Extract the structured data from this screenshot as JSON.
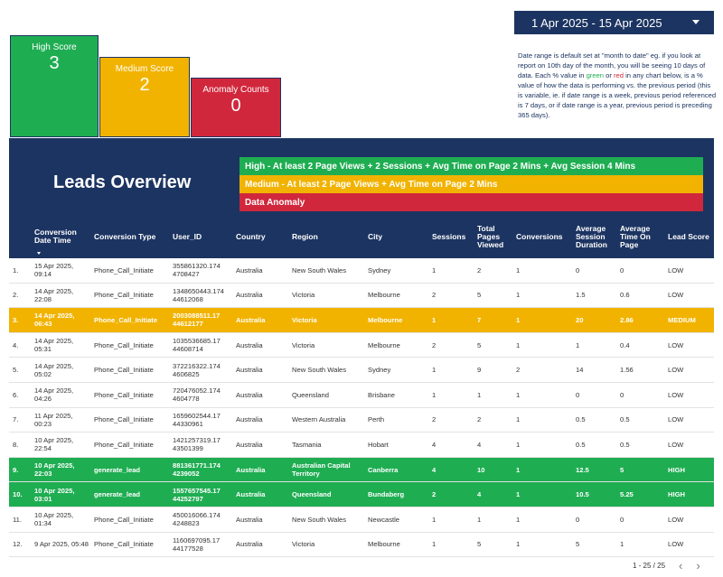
{
  "scorecards": {
    "high": {
      "label": "High Score",
      "value": "3"
    },
    "medium": {
      "label": "Medium Score",
      "value": "2"
    },
    "anomaly": {
      "label": "Anomaly Counts",
      "value": "0"
    }
  },
  "date_range": {
    "label": "1 Apr 2025 - 15 Apr 2025"
  },
  "note": {
    "part1": "Date range is default set at \"month to date\" eg. if you look at report on 10th day of the month, you will be seeing 10 days of data. Each % value in ",
    "green": "green",
    "mid": " or ",
    "red": "red",
    "part2": " in any chart below, is a % value of how the data is performing vs. the previous period (this is variable, ie. if date range is a week, previous period referenced is 7 days, or if date range is a year, previous period is preceding 365 days)."
  },
  "banner": {
    "title": "Leads Overview",
    "legend_high": "High -  At least 2 Page Views + 2 Sessions + Avg Time on Page 2 Mins + Avg Session 4 Mins",
    "legend_medium": "Medium -  At least 2 Page Views + Avg Time on Page 2 Mins",
    "legend_anomaly": "Data Anomaly"
  },
  "colors": {
    "navy": "#1c3461",
    "high": "#1fad52",
    "medium": "#f1b300",
    "anomaly": "#d1273c"
  },
  "table": {
    "columns": [
      "",
      "Conversion Date Time",
      "Conversion Type",
      "User_ID",
      "Country",
      "Region",
      "City",
      "Sessions",
      "Total Pages Viewed",
      "Conversions",
      "Average Session Duration",
      "Average Time On Page",
      "Lead Score"
    ],
    "rows": [
      [
        "1.",
        "15 Apr 2025, 09:14",
        "Phone_Call_Initiate",
        "355861320.174 4708427",
        "Australia",
        "New South Wales",
        "Sydney",
        "1",
        "2",
        "1",
        "0",
        "0",
        "LOW"
      ],
      [
        "2.",
        "14 Apr 2025, 22:08",
        "Phone_Call_Initiate",
        "1348650443.174 44612068",
        "Australia",
        "Victoria",
        "Melbourne",
        "2",
        "5",
        "1",
        "1.5",
        "0.6",
        "LOW"
      ],
      [
        "3.",
        "14 Apr 2025, 06:43",
        "Phone_Call_Initiate",
        "2003088511.17 44612177",
        "Australia",
        "Victoria",
        "Melbourne",
        "1",
        "7",
        "1",
        "20",
        "2.86",
        "MEDIUM"
      ],
      [
        "4.",
        "14 Apr 2025, 05:31",
        "Phone_Call_Initiate",
        "1035536685.17 44608714",
        "Australia",
        "Victoria",
        "Melbourne",
        "2",
        "5",
        "1",
        "1",
        "0.4",
        "LOW"
      ],
      [
        "5.",
        "14 Apr 2025, 05:02",
        "Phone_Call_Initiate",
        "372216322.174 4606825",
        "Australia",
        "New South Wales",
        "Sydney",
        "1",
        "9",
        "2",
        "14",
        "1.56",
        "LOW"
      ],
      [
        "6.",
        "14 Apr 2025, 04:26",
        "Phone_Call_Initiate",
        "720476052.174 4604778",
        "Australia",
        "Queensland",
        "Brisbane",
        "1",
        "1",
        "1",
        "0",
        "0",
        "LOW"
      ],
      [
        "7.",
        "11 Apr 2025, 00:23",
        "Phone_Call_Initiate",
        "1659602544.17 44330961",
        "Australia",
        "Western Australia",
        "Perth",
        "2",
        "2",
        "1",
        "0.5",
        "0.5",
        "LOW"
      ],
      [
        "8.",
        "10 Apr 2025, 22:54",
        "Phone_Call_Initiate",
        "1421257319.17 43501399",
        "Australia",
        "Tasmania",
        "Hobart",
        "4",
        "4",
        "1",
        "0.5",
        "0.5",
        "LOW"
      ],
      [
        "9.",
        "10 Apr 2025, 22:03",
        "generate_lead",
        "881361771.174 4239052",
        "Australia",
        "Australian Capital Territory",
        "Canberra",
        "4",
        "10",
        "1",
        "12.5",
        "5",
        "HIGH"
      ],
      [
        "10.",
        "10 Apr 2025, 03:01",
        "generate_lead",
        "1557657545.17 44252797",
        "Australia",
        "Queensland",
        "Bundaberg",
        "2",
        "4",
        "1",
        "10.5",
        "5.25",
        "HIGH"
      ],
      [
        "11.",
        "10 Apr 2025, 01:34",
        "Phone_Call_Initiate",
        "450016066.174 4248823",
        "Australia",
        "New South Wales",
        "Newcastle",
        "1",
        "1",
        "1",
        "0",
        "0",
        "LOW"
      ],
      [
        "12.",
        "9 Apr 2025, 05:48",
        "Phone_Call_Initiate",
        "1160697095.17 44177528",
        "Australia",
        "Victoria",
        "Melbourne",
        "1",
        "5",
        "1",
        "5",
        "1",
        "LOW"
      ]
    ]
  },
  "pager": {
    "label": "1 - 25 / 25",
    "prev": "‹",
    "next": "›"
  }
}
